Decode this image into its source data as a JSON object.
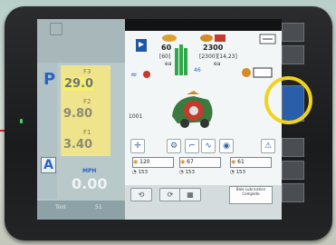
{
  "left_panel": {
    "gear_indicator": "P",
    "auto_indicator": "A",
    "f3_label": "F3",
    "f3_value": "29.0",
    "f2_label": "F2",
    "f2_value": "9.80",
    "f1_label": "F1",
    "f1_value": "3.40",
    "speed_unit": "MPH",
    "speed_value": "0.00",
    "tab_left": "Tool",
    "tab_right": "51"
  },
  "baler_panel": {
    "bale_count_main": "60",
    "bale_count_sub": "[60]",
    "bale_count_unit": "ea",
    "bale_total": "2300",
    "bale_total_sub": "[2300][14,23]",
    "bale_total_unit": "ea",
    "density_label": "46",
    "left_counter": "1001",
    "net_count_1": "120",
    "net_count_2": "67",
    "net_count_3": "61",
    "small_1": "153",
    "small_2": "153",
    "small_3": "153",
    "info_text": "Bale Lubrication Complete"
  },
  "colors": {
    "highlight_ring": "#f2d21c",
    "bar_green": "#2fa84a",
    "gear_blue": "#2b62c4",
    "gearbox_yellow": "#efe38b"
  }
}
